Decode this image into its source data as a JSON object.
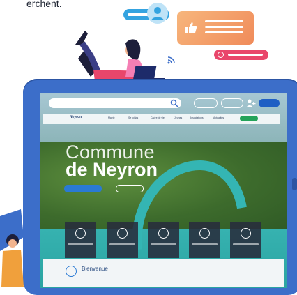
{
  "top_text": "erchent.",
  "site": {
    "logo": "Neyron",
    "nav_items": [
      "Mairie",
      "Se loisirs",
      "Cadre de vie",
      "Jeunes",
      "Associations",
      "Actualités"
    ],
    "hero_title_line1": "Commune",
    "hero_title_line2": "de Neyron",
    "welcome_text": "Bienvenue"
  },
  "icons": {
    "search": "search-icon",
    "user_plus": "user-plus-icon",
    "rss": "rss-icon",
    "thumbs_up": "thumbs-up-icon",
    "avatar": "avatar-icon"
  },
  "colors": {
    "tablet": "#3c6ec9",
    "accent_blue": "#34a3e0",
    "card_orange": "#f08b5a",
    "pill_pink": "#e9466b",
    "nav_green": "#24a35a"
  }
}
